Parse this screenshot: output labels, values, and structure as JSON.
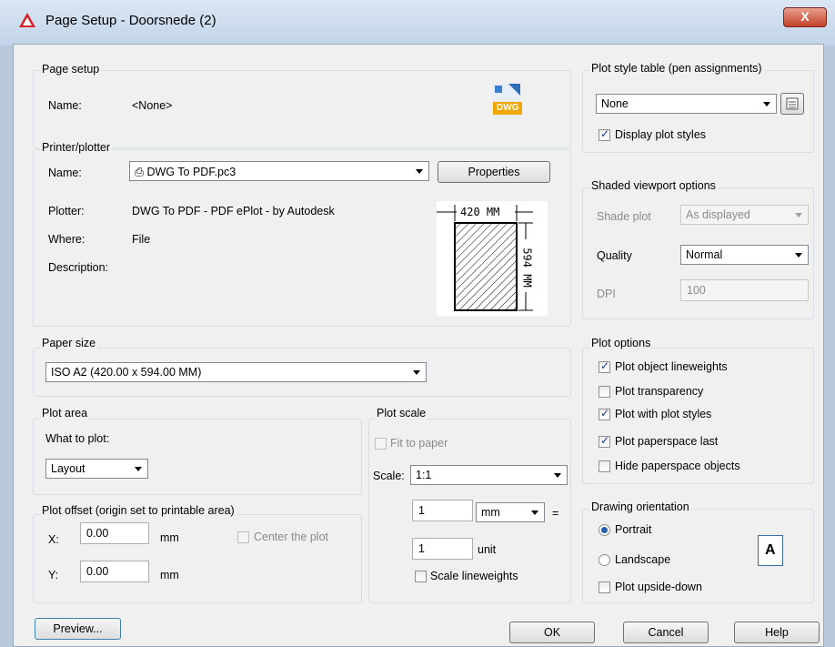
{
  "window": {
    "title": "Page Setup - Doorsnede (2)",
    "close_label": "X"
  },
  "page_setup": {
    "group_title": "Page setup",
    "name_label": "Name:",
    "name_value": "<None>",
    "icon_label": "DWG"
  },
  "printer": {
    "group_title": "Printer/plotter",
    "name_label": "Name:",
    "name_value": "DWG To PDF.pc3",
    "properties_label": "Properties",
    "plotter_label": "Plotter:",
    "plotter_value": "DWG To PDF - PDF ePlot - by Autodesk",
    "where_label": "Where:",
    "where_value": "File",
    "description_label": "Description:",
    "preview_width_label": "420 MM",
    "preview_height_label": "594 MM"
  },
  "paper_size": {
    "group_title": "Paper size",
    "value": "ISO A2 (420.00 x 594.00 MM)"
  },
  "plot_area": {
    "group_title": "Plot area",
    "what_label": "What to plot:",
    "value": "Layout"
  },
  "plot_offset": {
    "group_title": "Plot offset (origin set to printable area)",
    "x_label": "X:",
    "x_value": "0.00",
    "x_unit": "mm",
    "y_label": "Y:",
    "y_value": "0.00",
    "y_unit": "mm",
    "center_label": "Center the plot",
    "center_checked": false
  },
  "plot_scale": {
    "group_title": "Plot scale",
    "fit_label": "Fit to paper",
    "scale_label": "Scale:",
    "scale_value": "1:1",
    "value1": "1",
    "unit1": "mm",
    "equals": "=",
    "value2": "1",
    "unit2": "unit",
    "lineweights_label": "Scale lineweights"
  },
  "plot_style_table": {
    "group_title": "Plot style table (pen assignments)",
    "value": "None",
    "display_label": "Display plot styles"
  },
  "shaded_viewport": {
    "group_title": "Shaded viewport options",
    "shade_label": "Shade plot",
    "shade_value": "As displayed",
    "quality_label": "Quality",
    "quality_value": "Normal",
    "dpi_label": "DPI",
    "dpi_value": "100"
  },
  "plot_options": {
    "group_title": "Plot options",
    "items": [
      {
        "label": "Plot object lineweights",
        "checked": true
      },
      {
        "label": "Plot transparency",
        "checked": false
      },
      {
        "label": "Plot with plot styles",
        "checked": true
      },
      {
        "label": "Plot paperspace last",
        "checked": true
      },
      {
        "label": "Hide paperspace objects",
        "checked": false
      }
    ]
  },
  "drawing_orientation": {
    "group_title": "Drawing orientation",
    "portrait_label": "Portrait",
    "landscape_label": "Landscape",
    "upside_label": "Plot upside-down",
    "icon_letter": "A"
  },
  "footer": {
    "preview_label": "Preview...",
    "ok_label": "OK",
    "cancel_label": "Cancel",
    "help_label": "Help"
  }
}
